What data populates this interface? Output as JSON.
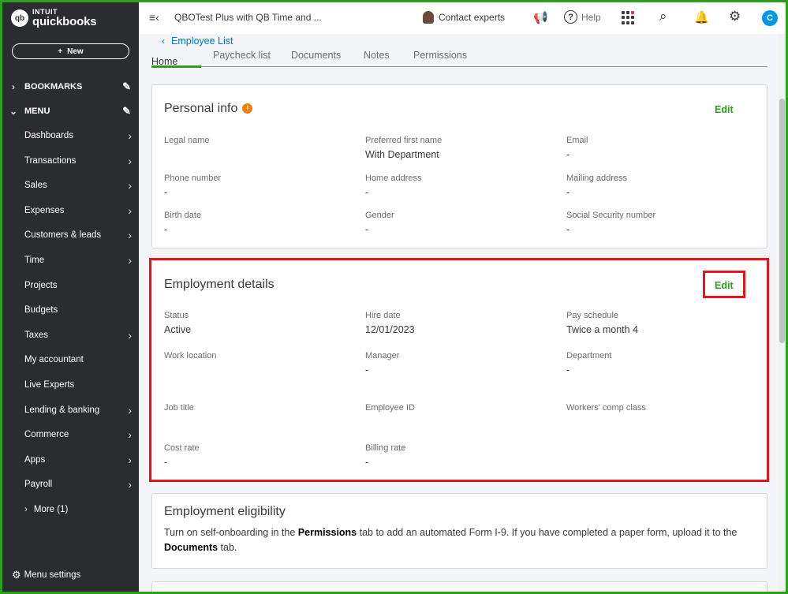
{
  "brand": {
    "top": "INTUIT",
    "name": "quickbooks",
    "badge": "qb"
  },
  "sidebar": {
    "new_label": "New",
    "bookmarks_label": "BOOKMARKS",
    "menu_label": "MENU",
    "items": [
      {
        "label": "Dashboards",
        "arrow": true
      },
      {
        "label": "Transactions",
        "arrow": true
      },
      {
        "label": "Sales",
        "arrow": true
      },
      {
        "label": "Expenses",
        "arrow": true
      },
      {
        "label": "Customers & leads",
        "arrow": true
      },
      {
        "label": "Time",
        "arrow": true
      },
      {
        "label": "Projects",
        "arrow": false
      },
      {
        "label": "Budgets",
        "arrow": false
      },
      {
        "label": "Taxes",
        "arrow": true
      },
      {
        "label": "My accountant",
        "arrow": false
      },
      {
        "label": "Live Experts",
        "arrow": false
      },
      {
        "label": "Lending & banking",
        "arrow": true
      },
      {
        "label": "Commerce",
        "arrow": true
      },
      {
        "label": "Apps",
        "arrow": true
      },
      {
        "label": "Payroll",
        "arrow": true
      }
    ],
    "more_label": "More (1)",
    "settings_label": "Menu settings"
  },
  "topbar": {
    "company": "QBOTest Plus with QB Time and ...",
    "contact_label": "Contact experts",
    "help_label": "Help",
    "user_initial": "C"
  },
  "breadcrumb": {
    "label": "Employee List"
  },
  "tabs": {
    "active": "Home",
    "items": [
      "Paycheck list",
      "Documents",
      "Notes",
      "Permissions"
    ]
  },
  "personal": {
    "title": "Personal info",
    "edit_label": "Edit",
    "fields": [
      {
        "label": "Legal name",
        "value": ""
      },
      {
        "label": "Preferred first name",
        "value": "With Department"
      },
      {
        "label": "Email",
        "value": "-"
      },
      {
        "label": "Phone number",
        "value": "-"
      },
      {
        "label": "Home address",
        "value": "-"
      },
      {
        "label": "Mailing address",
        "value": "-"
      },
      {
        "label": "Birth date",
        "value": "-"
      },
      {
        "label": "Gender",
        "value": "-"
      },
      {
        "label": "Social Security number",
        "value": "-"
      }
    ]
  },
  "employment": {
    "title": "Employment details",
    "edit_label": "Edit",
    "fields": [
      {
        "label": "Status",
        "value": "Active"
      },
      {
        "label": "Hire date",
        "value": "12/01/2023"
      },
      {
        "label": "Pay schedule",
        "value": "Twice a month 4"
      },
      {
        "label": "Work location",
        "value": ""
      },
      {
        "label": "Manager",
        "value": "-"
      },
      {
        "label": "Department",
        "value": "-"
      },
      {
        "label": "Job title",
        "value": ""
      },
      {
        "label": "Employee ID",
        "value": ""
      },
      {
        "label": "Workers' comp class",
        "value": ""
      },
      {
        "label": "Cost rate",
        "value": "-"
      },
      {
        "label": "Billing rate",
        "value": "-"
      }
    ]
  },
  "eligibility": {
    "title": "Employment eligibility",
    "text_1": "Turn on self-onboarding in the ",
    "bold_1": "Permissions",
    "text_2": " tab to add an automated Form I-9. If you have completed a paper form, upload it to the ",
    "bold_2": "Documents",
    "text_3": " tab."
  },
  "colors": {
    "accent": "#2ca01c",
    "sidebar_bg": "#2b2c2f",
    "link": "#0077c5",
    "highlight": "#e2161f",
    "warning": "#f57c00"
  }
}
